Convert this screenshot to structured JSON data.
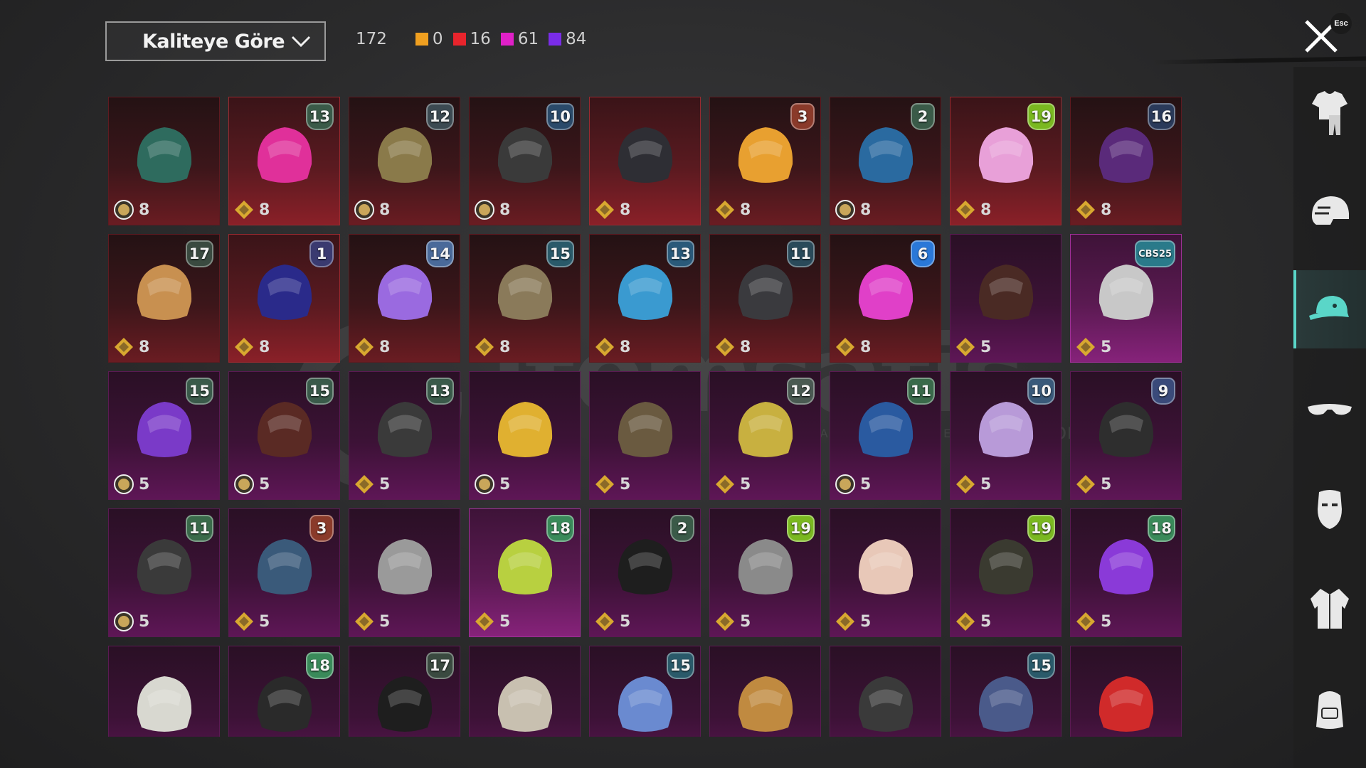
{
  "header": {
    "sort_label": "Kaliteye Göre",
    "total": "172",
    "rarity_counts": [
      {
        "color": "#f0a020",
        "count": "0"
      },
      {
        "color": "#e8242c",
        "count": "16"
      },
      {
        "color": "#e020c8",
        "count": "61"
      },
      {
        "color": "#7a2ce8",
        "count": "84"
      }
    ]
  },
  "close": {
    "shortcut": "Esc"
  },
  "watermark": {
    "brand": "itemsatis",
    "tagline": "HESAP / SKIN / İTEM / EPIN",
    "suffix": ".com"
  },
  "sidebar": {
    "categories": [
      {
        "name": "outfit",
        "icon": "outfit-icon",
        "active": false
      },
      {
        "name": "helmet",
        "icon": "helmet-icon",
        "active": false
      },
      {
        "name": "hat",
        "icon": "cap-icon",
        "active": true
      },
      {
        "name": "glasses",
        "icon": "glasses-icon",
        "active": false
      },
      {
        "name": "mask",
        "icon": "mask-icon",
        "active": false
      },
      {
        "name": "jacket",
        "icon": "jacket-icon",
        "active": false
      },
      {
        "name": "backpack",
        "icon": "backpack-icon",
        "active": false
      }
    ]
  },
  "items": [
    [
      {
        "rarity": "red",
        "badge": "",
        "currency": "coin",
        "cost": "8",
        "art": "#2e6b5e"
      },
      {
        "rarity": "red",
        "badge": "13",
        "badge_color": "#3a5a48",
        "currency": "gem",
        "cost": "8",
        "art": "#e0309a",
        "sel": true
      },
      {
        "rarity": "red",
        "badge": "12",
        "badge_color": "#3c4a52",
        "currency": "coin",
        "cost": "8",
        "art": "#8a7a4a"
      },
      {
        "rarity": "red",
        "badge": "10",
        "badge_color": "#2a4a6a",
        "currency": "coin",
        "cost": "8",
        "art": "#3a3a3a"
      },
      {
        "rarity": "red",
        "badge": "",
        "currency": "gem",
        "cost": "8",
        "art": "#2e2e34",
        "sel": true
      },
      {
        "rarity": "red",
        "badge": "3",
        "badge_color": "#8a3a2a",
        "currency": "gem",
        "cost": "8",
        "art": "#e8a030"
      },
      {
        "rarity": "red",
        "badge": "2",
        "badge_color": "#3a5a48",
        "currency": "coin",
        "cost": "8",
        "art": "#2a6aa0"
      },
      {
        "rarity": "red",
        "badge": "19",
        "badge_color": "#7ab820",
        "currency": "gem",
        "cost": "8",
        "art": "#e8a0d8",
        "sel": true
      },
      {
        "rarity": "red",
        "badge": "16",
        "badge_color": "#2a3a5a",
        "currency": "gem",
        "cost": "8",
        "art": "#5a2a7a"
      }
    ],
    [
      {
        "rarity": "red",
        "badge": "17",
        "badge_color": "#3a4a40",
        "currency": "gem",
        "cost": "8",
        "art": "#c89050"
      },
      {
        "rarity": "red",
        "badge": "1",
        "badge_color": "#3a3a70",
        "currency": "gem",
        "cost": "8",
        "art": "#2a2a8a",
        "sel": true
      },
      {
        "rarity": "red",
        "badge": "14",
        "badge_color": "#4a6a9a",
        "currency": "gem",
        "cost": "8",
        "art": "#9a6ae0"
      },
      {
        "rarity": "red",
        "badge": "15",
        "badge_color": "#2a5a6a",
        "currency": "gem",
        "cost": "8",
        "art": "#8a7a5a"
      },
      {
        "rarity": "red",
        "badge": "13",
        "badge_color": "#2a5a7a",
        "currency": "gem",
        "cost": "8",
        "art": "#3a9ad0"
      },
      {
        "rarity": "red",
        "badge": "11",
        "badge_color": "#2a4a5a",
        "currency": "gem",
        "cost": "8",
        "art": "#3a3a3e"
      },
      {
        "rarity": "red",
        "badge": "6",
        "badge_color": "#2a78d8",
        "currency": "gem",
        "cost": "8",
        "art": "#e040c8"
      },
      {
        "rarity": "pink",
        "badge": "",
        "currency": "gem",
        "cost": "5",
        "art": "#4a2a24"
      },
      {
        "rarity": "pink",
        "badge": "CBS25",
        "badge_color": "#2a7a8a",
        "currency": "gem",
        "cost": "5",
        "art": "#c8c8c8",
        "sel": true
      }
    ],
    [
      {
        "rarity": "pink",
        "badge": "15",
        "badge_color": "#3a5a4a",
        "currency": "coin",
        "cost": "5",
        "art": "#7a3ac8"
      },
      {
        "rarity": "pink",
        "badge": "15",
        "badge_color": "#3a5a4a",
        "currency": "coin",
        "cost": "5",
        "art": "#5a2a24"
      },
      {
        "rarity": "pink",
        "badge": "13",
        "badge_color": "#3a5a4a",
        "currency": "gem",
        "cost": "5",
        "art": "#3a3a3a"
      },
      {
        "rarity": "pink",
        "badge": "",
        "currency": "coin",
        "cost": "5",
        "art": "#e0b030"
      },
      {
        "rarity": "pink",
        "badge": "",
        "currency": "gem",
        "cost": "5",
        "art": "#6a5a40"
      },
      {
        "rarity": "pink",
        "badge": "12",
        "badge_color": "#4a5a52",
        "currency": "gem",
        "cost": "5",
        "art": "#c8b040"
      },
      {
        "rarity": "pink",
        "badge": "11",
        "badge_color": "#3a6a4a",
        "currency": "coin",
        "cost": "5",
        "art": "#2a5aa0"
      },
      {
        "rarity": "pink",
        "badge": "10",
        "badge_color": "#3a5a7a",
        "currency": "gem",
        "cost": "5",
        "art": "#b89ad8"
      },
      {
        "rarity": "pink",
        "badge": "9",
        "badge_color": "#3a4a7a",
        "currency": "gem",
        "cost": "5",
        "art": "#2e2e2e"
      }
    ],
    [
      {
        "rarity": "pink",
        "badge": "11",
        "badge_color": "#3a6a4a",
        "currency": "coin",
        "cost": "5",
        "art": "#3a3a3a"
      },
      {
        "rarity": "pink",
        "badge": "3",
        "badge_color": "#8a3a2a",
        "currency": "gem",
        "cost": "5",
        "art": "#3a5a7a"
      },
      {
        "rarity": "pink",
        "badge": "",
        "currency": "gem",
        "cost": "5",
        "art": "#9a9a9a"
      },
      {
        "rarity": "pink",
        "badge": "18",
        "badge_color": "#3a8a5a",
        "currency": "gem",
        "cost": "5",
        "art": "#b8d040",
        "sel": true
      },
      {
        "rarity": "pink",
        "badge": "2",
        "badge_color": "#3a5a48",
        "currency": "gem",
        "cost": "5",
        "art": "#1e1e1e"
      },
      {
        "rarity": "pink",
        "badge": "19",
        "badge_color": "#7ab820",
        "currency": "gem",
        "cost": "5",
        "art": "#8a8a8a"
      },
      {
        "rarity": "pink",
        "badge": "",
        "currency": "gem",
        "cost": "5",
        "art": "#e8c8b8"
      },
      {
        "rarity": "pink",
        "badge": "19",
        "badge_color": "#7ab820",
        "currency": "gem",
        "cost": "5",
        "art": "#3a3a30"
      },
      {
        "rarity": "pink",
        "badge": "18",
        "badge_color": "#3a8a5a",
        "currency": "gem",
        "cost": "5",
        "art": "#8a3ad8"
      }
    ],
    [
      {
        "rarity": "pink",
        "badge": "",
        "currency": "gem",
        "cost": "",
        "art": "#d8d8d0"
      },
      {
        "rarity": "pink",
        "badge": "18",
        "badge_color": "#3a8a5a",
        "currency": "gem",
        "cost": "",
        "art": "#2a2a2a"
      },
      {
        "rarity": "pink",
        "badge": "17",
        "badge_color": "#3a4a40",
        "currency": "gem",
        "cost": "",
        "art": "#1e1e1e"
      },
      {
        "rarity": "pink",
        "badge": "",
        "currency": "gem",
        "cost": "",
        "art": "#c8c0b0"
      },
      {
        "rarity": "pink",
        "badge": "15",
        "badge_color": "#2a5a6a",
        "currency": "gem",
        "cost": "",
        "art": "#6a8ad0"
      },
      {
        "rarity": "pink",
        "badge": "",
        "currency": "gem",
        "cost": "",
        "art": "#c08a40"
      },
      {
        "rarity": "pink",
        "badge": "",
        "currency": "gem",
        "cost": "",
        "art": "#3a3a3a"
      },
      {
        "rarity": "pink",
        "badge": "15",
        "badge_color": "#2a5a6a",
        "currency": "gem",
        "cost": "",
        "art": "#4a5a8a"
      },
      {
        "rarity": "pink",
        "badge": "",
        "currency": "gem",
        "cost": "",
        "art": "#d02a2a"
      }
    ]
  ]
}
